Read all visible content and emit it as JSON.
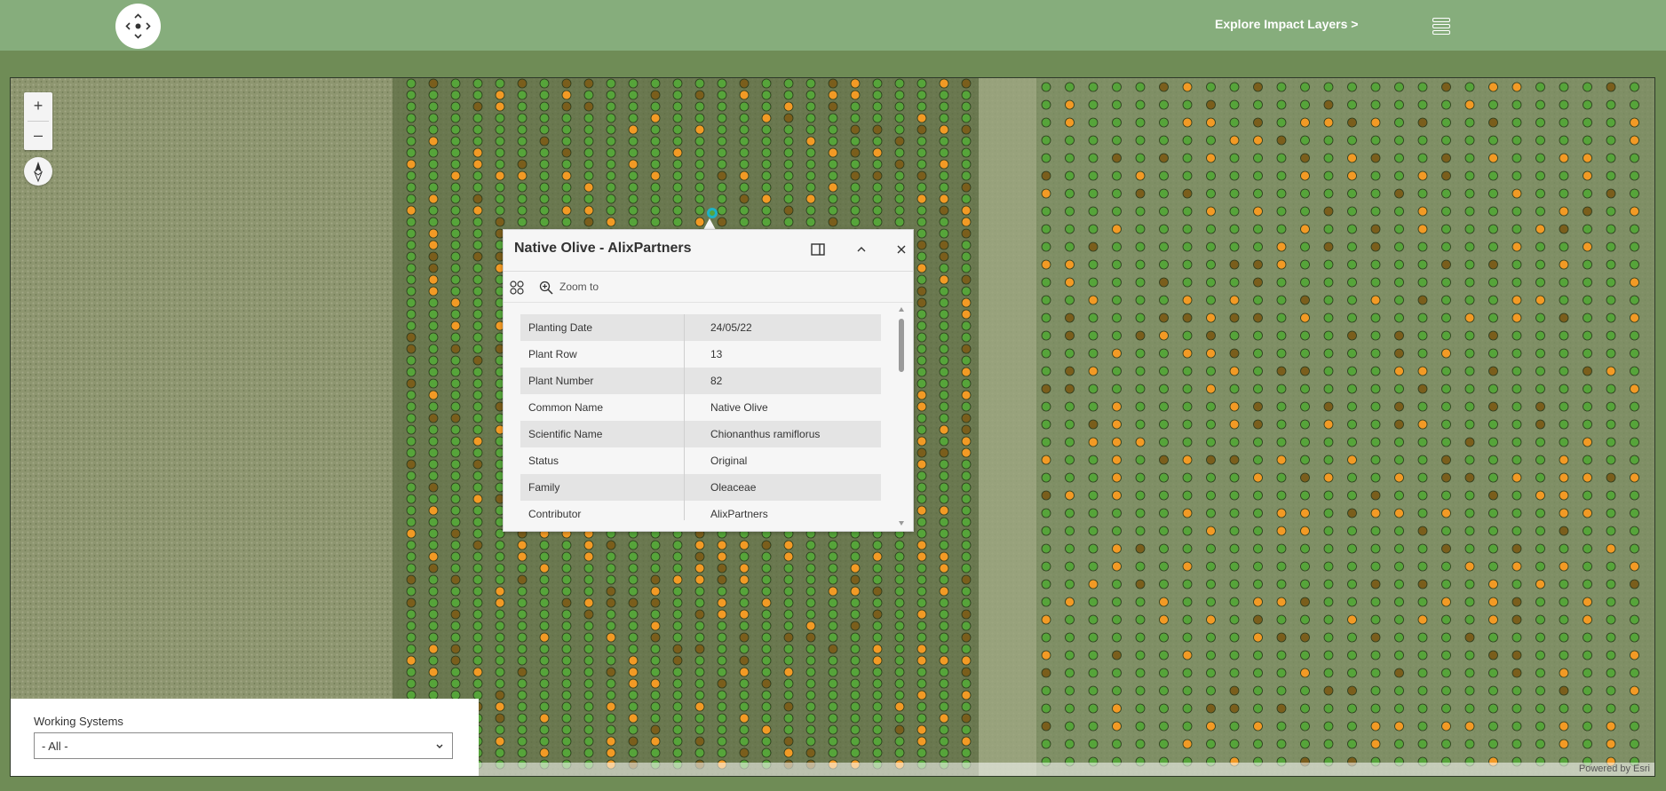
{
  "header": {
    "explore_label": "Explore Impact Layers >"
  },
  "map": {
    "zoom_in": "+",
    "zoom_out": "–",
    "attribution": "Powered by Esri"
  },
  "popup": {
    "title": "Native Olive - AlixPartners",
    "zoom_to_label": "Zoom to",
    "fields": [
      {
        "key": "Planting Date",
        "value": "24/05/22"
      },
      {
        "key": "Plant Row",
        "value": "13"
      },
      {
        "key": "Plant Number",
        "value": "82"
      },
      {
        "key": "Common Name",
        "value": "Native Olive"
      },
      {
        "key": "Scientific Name",
        "value": "Chionanthus ramiflorus"
      },
      {
        "key": "Status",
        "value": "Original"
      },
      {
        "key": "Family",
        "value": "Oleaceae"
      },
      {
        "key": "Contributor",
        "value": "AlixPartners"
      }
    ]
  },
  "working_systems": {
    "label": "Working Systems",
    "selected": "- All -"
  },
  "colors": {
    "header_bg": "#86ad7c",
    "page_bg": "#6f8c56",
    "plant_green": "#56a43a",
    "plant_orange": "#f29a25",
    "plant_brown": "#7a5e1c",
    "selection_ring": "#1fb1c4"
  }
}
